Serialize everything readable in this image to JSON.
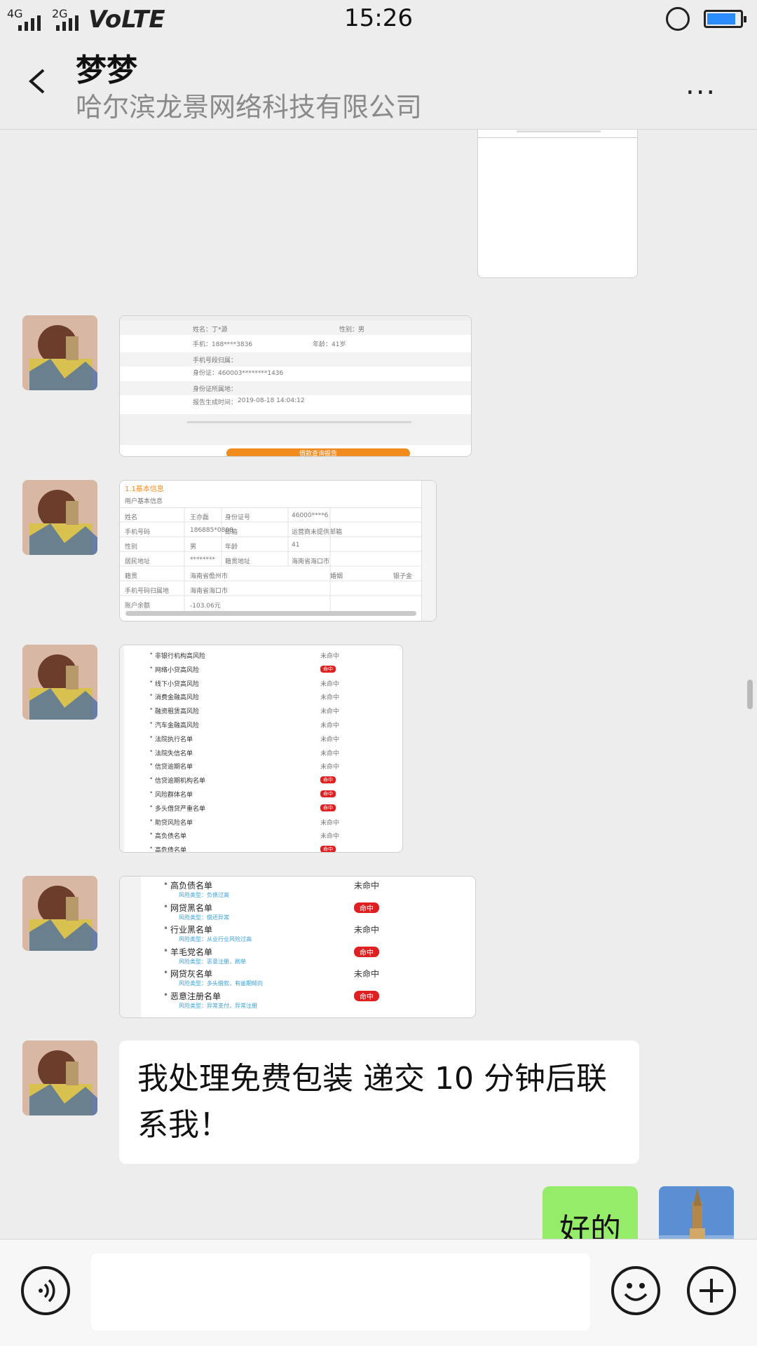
{
  "status": {
    "net1": "4G",
    "net2": "2G",
    "carrier": "VoLTE",
    "time": "15:26"
  },
  "header": {
    "title": "梦梦",
    "subtitle": "哈尔滨龙景网络科技有限公司",
    "more_label": "..."
  },
  "messages": {
    "report1": {
      "rows": [
        "姓名：丁*源",
        "性别：男",
        "手机：188****3836",
        "年龄：41岁",
        "手机号段归属：",
        "身份证：460003********1436",
        "身份证所属地：",
        "报告生成时间：",
        "2019-08-18 14:04:12"
      ],
      "button": "借款查询报告"
    },
    "report2": {
      "heading": "1.1基本信息",
      "subheading": "用户基本信息",
      "cells": [
        "姓名",
        "王亦磊",
        "身份证号",
        "46000****6",
        "手机号码",
        "186885*0808",
        "邮箱",
        "运营商未提供邮箱",
        "性别",
        "男",
        "年龄",
        "41",
        "居民地址",
        "********",
        "籍贯地址",
        "海南省海口市",
        "籍贯",
        "海南省儋州市",
        "婚姻",
        "银子金",
        "手机号码归属地",
        "海南省海口市",
        "账户余额",
        "-103.06元"
      ]
    },
    "report3": {
      "items": [
        {
          "label": "非银行机构高风险",
          "status": "未命中"
        },
        {
          "label": "网络小贷高风险",
          "status": "命中"
        },
        {
          "label": "线下小贷高风险",
          "status": "未命中"
        },
        {
          "label": "消费金融高风险",
          "status": "未命中"
        },
        {
          "label": "融资租赁高风险",
          "status": "未命中"
        },
        {
          "label": "汽车金融高风险",
          "status": "未命中"
        },
        {
          "label": "法院执行名单",
          "status": "未命中"
        },
        {
          "label": "法院失信名单",
          "status": "未命中"
        },
        {
          "label": "信贷逾期名单",
          "status": "未命中"
        },
        {
          "label": "信贷逾期机构名单",
          "status": "命中"
        },
        {
          "label": "风险群体名单",
          "status": "命中"
        },
        {
          "label": "多头借贷严重名单",
          "status": "命中"
        },
        {
          "label": "助贷风险名单",
          "status": "未命中"
        },
        {
          "label": "高负债名单",
          "status": "未命中"
        },
        {
          "label": "高危债名单",
          "status": "命中"
        }
      ]
    },
    "report4": {
      "items": [
        {
          "label": "高负债名单",
          "note": "风险类型：负债过高",
          "status": "未命中"
        },
        {
          "label": "网贷黑名单",
          "note": "风险类型：偿还异常",
          "status": "命中"
        },
        {
          "label": "行业黑名单",
          "note": "风险类型：从业行业风险过高",
          "status": "未命中"
        },
        {
          "label": "羊毛党名单",
          "note": "风险类型：恶意注册，刷单",
          "status": "命中"
        },
        {
          "label": "网贷灰名单",
          "note": "风险类型：多头借款，有逾期倾向",
          "status": "未命中"
        },
        {
          "label": "恶意注册名单",
          "note": "风险类型：异常支付，异常注册",
          "status": "命中"
        }
      ]
    },
    "text_message": "我处理免费包装 递交 10 分钟后联系我！",
    "my_reply": "好的"
  }
}
